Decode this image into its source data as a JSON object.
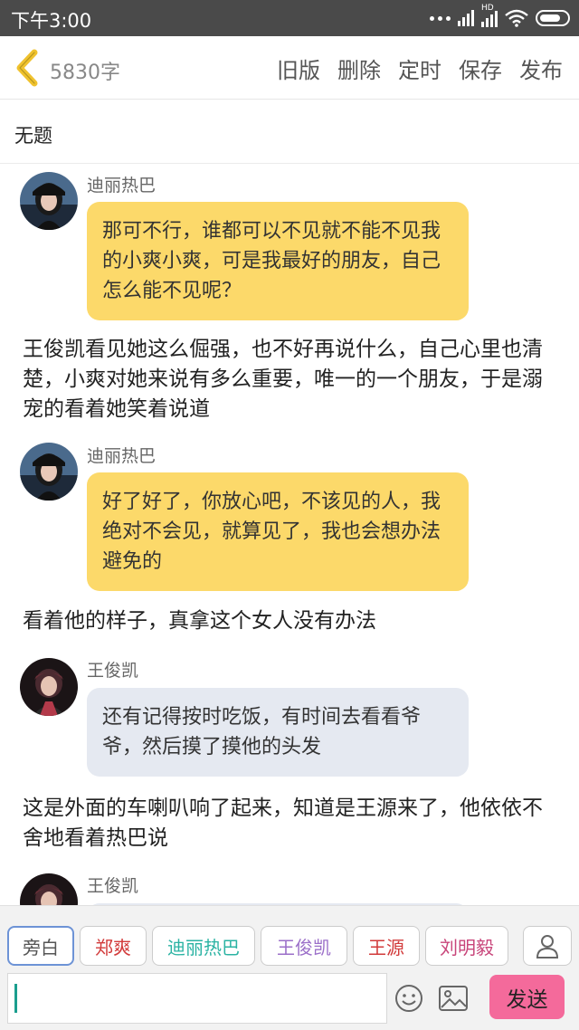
{
  "status_bar": {
    "time": "下午3:00",
    "network": "HD"
  },
  "toolbar": {
    "word_count": "5830字",
    "actions": [
      "旧版",
      "删除",
      "定时",
      "保存",
      "发布"
    ]
  },
  "title": "无题",
  "messages": [
    {
      "type": "chat",
      "sender": "迪丽热巴",
      "style": "yellow",
      "text": "那可不行，谁都可以不见就不能不见我的小爽小爽，可是我最好的朋友，自己怎么能不见呢？"
    },
    {
      "type": "narration",
      "text": "王俊凯看见她这么倔强，也不好再说什么，自己心里也清楚，小爽对她来说有多么重要，唯一的一个朋友，于是溺宠的看着她笑着说道"
    },
    {
      "type": "chat",
      "sender": "迪丽热巴",
      "style": "yellow",
      "text": "好了好了，你放心吧，不该见的人，我绝对不会见，就算见了，我也会想办法避免的"
    },
    {
      "type": "narration",
      "text": "看着他的样子，真拿这个女人没有办法"
    },
    {
      "type": "chat",
      "sender": "王俊凯",
      "style": "gray",
      "text": "还有记得按时吃饭，有时间去看看爷爷，然后摸了摸他的头发"
    },
    {
      "type": "narration",
      "text": "这是外面的车喇叭响了起来，知道是王源来了，他依依不舍地看着热巴说"
    },
    {
      "type": "chat",
      "sender": "王俊凯",
      "style": "gray",
      "text": ""
    }
  ],
  "roles": [
    {
      "label": "旁白",
      "color": "#555555",
      "active": true
    },
    {
      "label": "郑爽",
      "color": "#d23a3a",
      "active": false
    },
    {
      "label": "迪丽热巴",
      "color": "#2bb3a3",
      "active": false
    },
    {
      "label": "王俊凯",
      "color": "#9b6fc9",
      "active": false
    },
    {
      "label": "王源",
      "color": "#d23a3a",
      "active": false
    },
    {
      "label": "刘明毅",
      "color": "#c8457a",
      "active": false
    }
  ],
  "composer": {
    "value": "",
    "send_label": "发送"
  },
  "colors": {
    "yellow_bubble": "#fcd96a",
    "gray_bubble": "#e5e9f1",
    "send_button": "#f46a9b",
    "back_icon": "#f0c22e"
  }
}
